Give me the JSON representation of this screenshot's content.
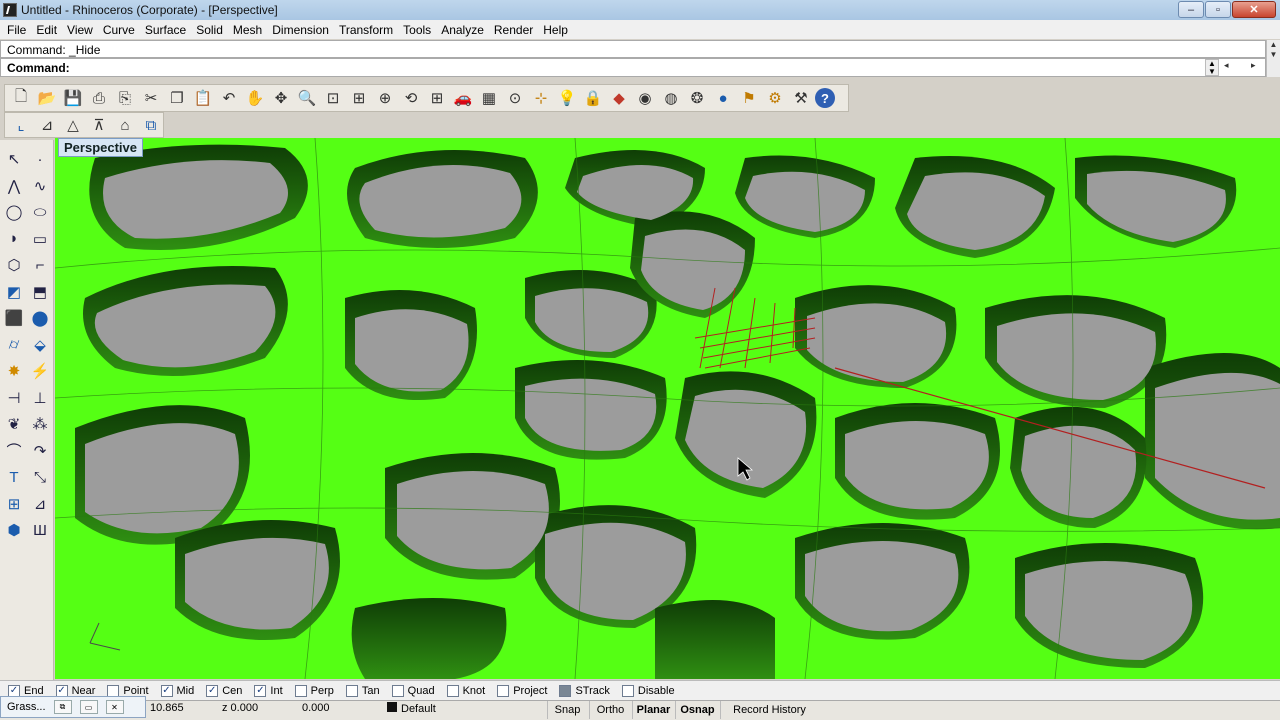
{
  "window": {
    "title": "Untitled - Rhinoceros (Corporate) - [Perspective]",
    "minimize": "–",
    "maximize": "▫",
    "close": "✕"
  },
  "menu": [
    "File",
    "Edit",
    "View",
    "Curve",
    "Surface",
    "Solid",
    "Mesh",
    "Dimension",
    "Transform",
    "Tools",
    "Analyze",
    "Render",
    "Help"
  ],
  "command": {
    "history": "Command: _Hide",
    "prompt": "Command:"
  },
  "toolbar_icons": [
    "new-icon",
    "open-icon",
    "save-icon",
    "print-icon",
    "import-icon",
    "cut-icon",
    "copy-icon",
    "paste-icon",
    "undo-icon",
    "pan-icon",
    "move-icon",
    "zoom-icon",
    "zoom-window-icon",
    "zoom-extents-icon",
    "zoom-selected-icon",
    "rotate-view-icon",
    "four-viewports-icon",
    "car-icon",
    "cplane-icon",
    "circle-point-icon",
    "osnap-icon",
    "light-icon",
    "lock-icon",
    "layer-icon",
    "color-wheel-icon",
    "wireframe-sphere-icon",
    "render-sphere-icon",
    "shaded-sphere-icon",
    "render-icon",
    "settings-icon",
    "tool-options-icon",
    "help-icon"
  ],
  "viewport": {
    "label": "Perspective",
    "object_color": "#55ff14"
  },
  "osnaps": [
    {
      "label": "End",
      "checked": true
    },
    {
      "label": "Near",
      "checked": true
    },
    {
      "label": "Point",
      "checked": false
    },
    {
      "label": "Mid",
      "checked": true
    },
    {
      "label": "Cen",
      "checked": true
    },
    {
      "label": "Int",
      "checked": true
    },
    {
      "label": "Perp",
      "checked": false
    },
    {
      "label": "Tan",
      "checked": false
    },
    {
      "label": "Quad",
      "checked": false
    },
    {
      "label": "Knot",
      "checked": false
    },
    {
      "label": "Project",
      "checked": false
    },
    {
      "label": "STrack",
      "checked": false
    },
    {
      "label": "Disable",
      "checked": false
    }
  ],
  "status": {
    "layer_tab": "Grass...",
    "x": "10.865",
    "z": "z 0.000",
    "d": "0.000",
    "layer": "Default",
    "snap": "Snap",
    "ortho": "Ortho",
    "planar": "Planar",
    "osnap": "Osnap",
    "record_history": "Record History"
  }
}
